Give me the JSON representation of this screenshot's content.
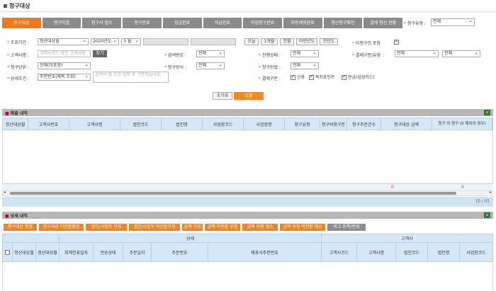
{
  "page": {
    "title": "청구대상"
  },
  "tabs": [
    "청구대상",
    "청구미결",
    "청구서 접수",
    "청구완료",
    "입금완료",
    "지급완료",
    "미입청구완료",
    "자동제외완료",
    "청산청구확인",
    "결제 청산 현황"
  ],
  "claim_type": {
    "label": "청구유형 :",
    "value": "전체"
  },
  "form": {
    "inquiry_period": {
      "label": "조회기간 :",
      "basis": "청산대상월",
      "year": "2020년도",
      "month": "3 월",
      "date_from": "",
      "date_to": "",
      "btn_today": "오늘",
      "btn_1month": "1개월",
      "btn_lastmonth": "전월",
      "btn_thismonth": "이번년도",
      "btn_lastyear": "전년도"
    },
    "contract_incl": {
      "label": "미청구건 포함"
    },
    "customer_name": {
      "label": "고객사명 :",
      "placeholder": "고객사코드 혹은 고객사명",
      "btn": "찾기"
    },
    "contract_no": {
      "label": "검색번호 :",
      "value": "전체"
    },
    "progress_status": {
      "label": "진행상태 :",
      "value": "전체"
    },
    "approval_type": {
      "label": "결제구분/유형 :",
      "value1": "전체",
      "value2": "전체"
    },
    "claim_unit": {
      "label": "청구단위 :",
      "value": "전체(미포함)"
    },
    "claim_method": {
      "label": "청구방식 :",
      "value": "전체"
    },
    "claim_path": {
      "label": "청구방법 :",
      "value": "전체"
    },
    "detail_cond": {
      "label": "상세조건 :",
      "value": "주문번호(제목 조회)",
      "placeholder": "검색어 및 조건 입력 후 구분하십시오"
    },
    "settle_type": {
      "label": "결제구분 :",
      "opt1": "신용",
      "opt2": "복지포인트",
      "opt3": "현금(삼성카드)"
    }
  },
  "buttons": {
    "reset": "초기화",
    "search": "조회"
  },
  "sales_grid": {
    "title": "매출 내역",
    "columns": [
      "청산대상월",
      "고객사번호",
      "고객사명",
      "법인코드",
      "법인명",
      "사업장코드",
      "사업장명",
      "청구유형",
      "청구비용구분",
      "청구주문건수",
      "청구대상 금액",
      "청구 외 청구 (0 제외의 경우)"
    ],
    "sum_left": "0",
    "sum_right": "0",
    "paging": "[0 / 0]"
  },
  "detail_grid": {
    "title": "상세 내역",
    "action_buttons": [
      "청구대상 확정",
      "청구대상 미전환확정",
      "법인/사업부 부정",
      "법인/사업부 미전환부정",
      "금액 부정",
      "금액 미전환 부정",
      "금액 부정 해소",
      "금액 부정 미전환 해소",
      "비고 등록/변경"
    ],
    "group_header_left": "상세",
    "group_header_right": "고객사",
    "columns": [
      "청산대상월",
      "정산대상월",
      "회계전표일자",
      "전송상태",
      "주문일자",
      "주문번호",
      "제휴사주문번호",
      "고객사코드",
      "고객사명",
      "법인코드",
      "법인명",
      "사업장코드"
    ]
  }
}
